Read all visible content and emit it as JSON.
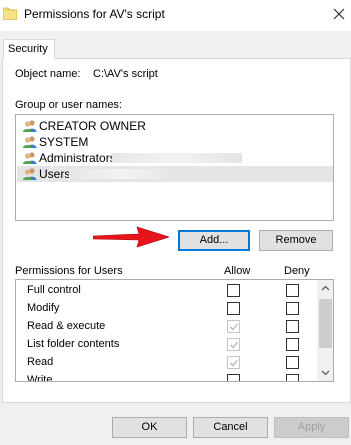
{
  "window": {
    "title": "Permissions for AV's script"
  },
  "tabs": [
    {
      "label": "Security"
    }
  ],
  "security": {
    "object_name_label": "Object name:",
    "object_name_value": "C:\\AV's script",
    "group_label": "Group or user names:",
    "users": [
      {
        "label": "CREATOR OWNER",
        "selected": false
      },
      {
        "label": "SYSTEM",
        "selected": false
      },
      {
        "label": "Administrators",
        "selected": false
      },
      {
        "label": "Users",
        "selected": true
      }
    ],
    "add_label": "Add...",
    "remove_label": "Remove",
    "permissions_label": "Permissions for Users",
    "allow_header": "Allow",
    "deny_header": "Deny",
    "permissions": [
      {
        "name": "Full control",
        "allow": false,
        "allow_disabled": false,
        "deny": false
      },
      {
        "name": "Modify",
        "allow": false,
        "allow_disabled": false,
        "deny": false
      },
      {
        "name": "Read & execute",
        "allow": true,
        "allow_disabled": true,
        "deny": false
      },
      {
        "name": "List folder contents",
        "allow": true,
        "allow_disabled": true,
        "deny": false
      },
      {
        "name": "Read",
        "allow": true,
        "allow_disabled": true,
        "deny": false
      },
      {
        "name": "Write",
        "allow": false,
        "allow_disabled": false,
        "deny": false
      }
    ]
  },
  "footer": {
    "ok_label": "OK",
    "cancel_label": "Cancel",
    "apply_label": "Apply"
  },
  "colors": {
    "accent": "#0078d7",
    "arrow": "#e8141b",
    "dialog_bg": "#f0f0f0"
  }
}
